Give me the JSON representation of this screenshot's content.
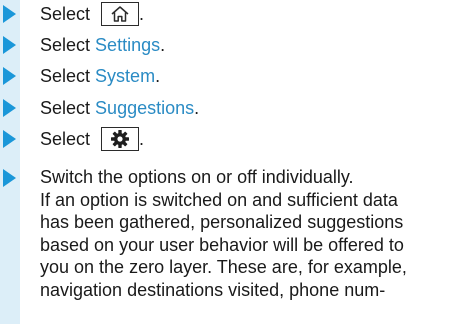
{
  "steps": [
    {
      "prefix": "Select",
      "link": "",
      "icon": "home-icon"
    },
    {
      "prefix": "Select",
      "link": "Settings",
      "suffix": "."
    },
    {
      "prefix": "Select",
      "link": "System",
      "suffix": "."
    },
    {
      "prefix": "Select",
      "link": "Suggestions",
      "suffix": "."
    },
    {
      "prefix": "Select",
      "link": "",
      "icon": "settings-gear-icon"
    }
  ],
  "final_step": {
    "lines": [
      "Switch the options on or off individually.",
      "If an option is switched on and sufficient data",
      "has been gathered, personalized suggestions",
      "based on your user behavior will be offered to",
      "you on the zero layer. These are, for example,",
      "navigation destinations visited, phone num-"
    ]
  },
  "colors": {
    "bullet": "#1a97d9",
    "link": "#2a8bc4",
    "sidebar": "#dceef8"
  }
}
